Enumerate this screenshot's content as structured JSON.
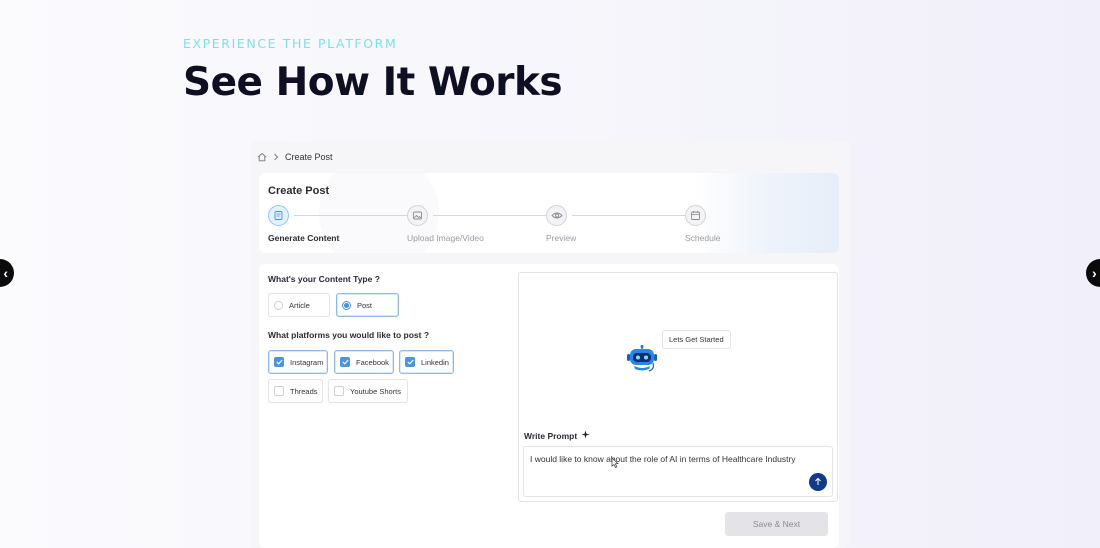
{
  "hero": {
    "eyebrow": "EXPERIENCE THE PLATFORM",
    "title": "See How It Works"
  },
  "breadcrumb": {
    "items": [
      "Create Post"
    ]
  },
  "stepper": {
    "title": "Create Post",
    "steps": [
      {
        "label": "Generate Content",
        "icon": "edit-icon",
        "active": true
      },
      {
        "label": "Upload Image/Video",
        "icon": "image-icon",
        "active": false
      },
      {
        "label": "Preview",
        "icon": "eye-icon",
        "active": false
      },
      {
        "label": "Schedule",
        "icon": "calendar-icon",
        "active": false
      }
    ]
  },
  "content_type": {
    "question": "What's your Content Type ?",
    "options": [
      {
        "label": "Article",
        "selected": false
      },
      {
        "label": "Post",
        "selected": true
      }
    ]
  },
  "platforms": {
    "question": "What platforms you would like to post ?",
    "options": [
      {
        "label": "Instagram",
        "checked": true
      },
      {
        "label": "Facebook",
        "checked": true
      },
      {
        "label": "Linkedin",
        "checked": true
      },
      {
        "label": "Threads",
        "checked": false
      },
      {
        "label": "Youtube Shorts",
        "checked": false
      }
    ]
  },
  "chat": {
    "bubble": "Lets Get Started",
    "prompt_label": "Write Prompt",
    "prompt_value": "I would like to know about the role of AI in terms of Healthcare Industry"
  },
  "actions": {
    "save_next": "Save & Next"
  },
  "colors": {
    "accent": "#4a95dc",
    "send_button": "#123a87",
    "eyebrow": "#7ee0e6"
  }
}
